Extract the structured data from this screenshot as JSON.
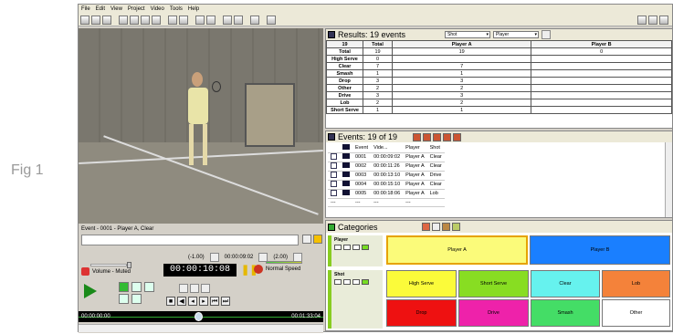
{
  "figure_label": "Fig 1",
  "menu": [
    "File",
    "Edit",
    "View",
    "Project",
    "Video",
    "Tools",
    "Help"
  ],
  "player_controls": {
    "event_title": "Event - 0001 - Player A, Clear",
    "rate_minus": "(-1.00)",
    "position_time": "00:00:09:02",
    "rate_plus": "(2.00)",
    "volume_label": "Volume - Muted",
    "timer": "00:00:10:08",
    "speed_label": "Normal Speed",
    "timeline_start": "00:00:00:00",
    "timeline_end": "00:01:33:04",
    "timeline_position": 0.49
  },
  "results": {
    "title": "Results: 19 events",
    "select1": "Shot",
    "select2": "Player",
    "header": [
      "19",
      "Total",
      "Player A",
      "Player B"
    ],
    "rows": [
      [
        "Total",
        "19",
        "19",
        "0"
      ],
      [
        "High Serve",
        "0",
        "",
        ""
      ],
      [
        "Clear",
        "7",
        "7",
        ""
      ],
      [
        "Smash",
        "1",
        "1",
        ""
      ],
      [
        "Drop",
        "3",
        "3",
        ""
      ],
      [
        "Other",
        "2",
        "2",
        ""
      ],
      [
        "Drive",
        "3",
        "3",
        ""
      ],
      [
        "Lob",
        "2",
        "2",
        ""
      ],
      [
        "Short Serve",
        "1",
        "1",
        ""
      ]
    ]
  },
  "events": {
    "title": "Events: 19 of 19",
    "header": [
      "Event",
      "Vide...",
      "Player",
      "Shot"
    ],
    "rows": [
      [
        "0001",
        "00:00:09:02",
        "Player A",
        "Clear"
      ],
      [
        "0002",
        "00:00:11:26",
        "Player A",
        "Clear"
      ],
      [
        "0003",
        "00:00:13:10",
        "Player A",
        "Drive"
      ],
      [
        "0004",
        "00:00:15:10",
        "Player A",
        "Clear"
      ],
      [
        "0005",
        "00:00:18:06",
        "Player A",
        "Lob"
      ]
    ],
    "filter_row": [
      "---",
      "---",
      "---",
      "---"
    ]
  },
  "categories": {
    "title": "Categories",
    "player_group": "Player",
    "shot_group": "Shot",
    "player_buttons": [
      {
        "label": "Player A",
        "color": "#fbfb7a"
      },
      {
        "label": "Player B",
        "color": "#1a7fff"
      }
    ],
    "shot_buttons": [
      {
        "label": "High Serve",
        "color": "#fbfb3a"
      },
      {
        "label": "Short Serve",
        "color": "#88dd22"
      },
      {
        "label": "Clear",
        "color": "#66f2ee"
      },
      {
        "label": "Lob",
        "color": "#f4823a"
      },
      {
        "label": "Drop",
        "color": "#ee1111"
      },
      {
        "label": "Drive",
        "color": "#ee22aa"
      },
      {
        "label": "Smash",
        "color": "#44dd66"
      },
      {
        "label": "Other",
        "color": "#ffffff"
      }
    ]
  }
}
